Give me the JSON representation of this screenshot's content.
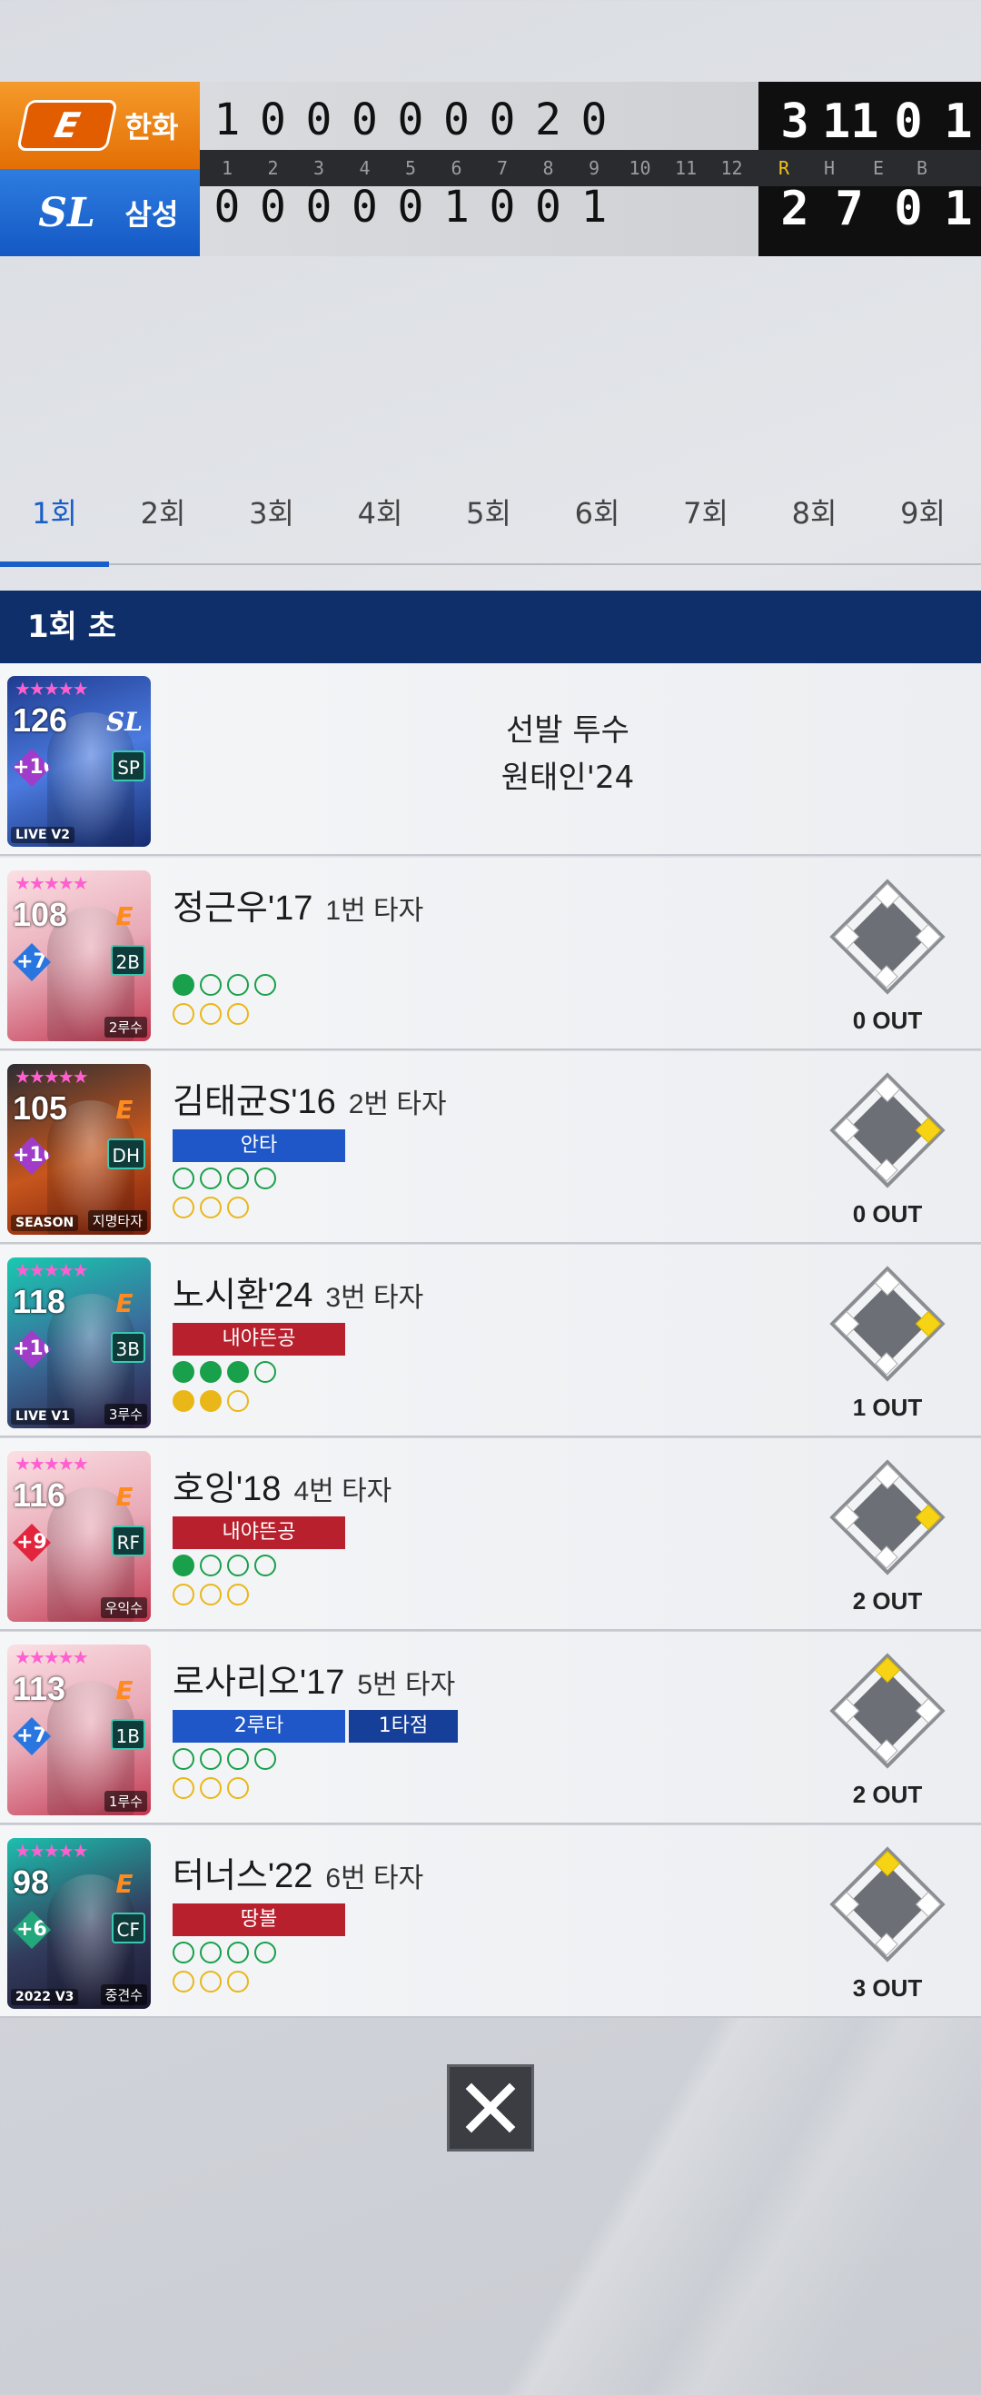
{
  "scoreboard": {
    "away": {
      "name": "한화",
      "innings": [
        "1",
        "0",
        "0",
        "0",
        "0",
        "0",
        "0",
        "2",
        "0"
      ],
      "totals": [
        "3",
        "11",
        "0",
        "1"
      ]
    },
    "home": {
      "name": "삼성",
      "innings": [
        "0",
        "0",
        "0",
        "0",
        "0",
        "1",
        "0",
        "0",
        "1"
      ],
      "totals": [
        "2",
        "7",
        "0",
        "1"
      ]
    },
    "inning_numbers": [
      "1",
      "2",
      "3",
      "4",
      "5",
      "6",
      "7",
      "8",
      "9",
      "10",
      "11",
      "12"
    ],
    "total_headers": [
      "R",
      "H",
      "E",
      "B"
    ]
  },
  "tabs": [
    "1회",
    "2회",
    "3회",
    "4회",
    "5회",
    "6회",
    "7회",
    "8회",
    "9회"
  ],
  "active_tab": 0,
  "inning_header": "1회 초",
  "pitcher": {
    "role_label": "선발 투수",
    "name": "원태인'24",
    "ovr": "126",
    "plus": "+10",
    "position": "SP",
    "tag": "LIVE V2"
  },
  "batters": [
    {
      "name": "정근우'17",
      "order": "1번 타자",
      "ovr": "108",
      "plus": "+7",
      "position": "2B",
      "role": "2루수",
      "tag": "",
      "results": [],
      "balls": 1,
      "outs_dots": 0,
      "bases": {
        "first": false,
        "second": false,
        "third": false
      },
      "out_text": "0 OUT"
    },
    {
      "name": "김태균S'16",
      "order": "2번 타자",
      "ovr": "105",
      "plus": "+10",
      "position": "DH",
      "role": "지명타자",
      "tag": "SEASON",
      "results": [
        "안타"
      ],
      "balls": 0,
      "outs_dots": 0,
      "bases": {
        "first": true,
        "second": false,
        "third": false
      },
      "out_text": "0 OUT"
    },
    {
      "name": "노시환'24",
      "order": "3번 타자",
      "ovr": "118",
      "plus": "+10",
      "position": "3B",
      "role": "3루수",
      "tag": "LIVE V1",
      "results": [
        "내야뜬공"
      ],
      "balls": 3,
      "outs_dots": 2,
      "bases": {
        "first": true,
        "second": false,
        "third": false
      },
      "out_text": "1 OUT"
    },
    {
      "name": "호잉'18",
      "order": "4번 타자",
      "ovr": "116",
      "plus": "+9",
      "position": "RF",
      "role": "우익수",
      "tag": "",
      "results": [
        "내야뜬공"
      ],
      "balls": 1,
      "outs_dots": 0,
      "bases": {
        "first": true,
        "second": false,
        "third": false
      },
      "out_text": "2 OUT"
    },
    {
      "name": "로사리오'17",
      "order": "5번 타자",
      "ovr": "113",
      "plus": "+7",
      "position": "1B",
      "role": "1루수",
      "tag": "",
      "results": [
        "2루타",
        "1타점"
      ],
      "balls": 0,
      "outs_dots": 0,
      "bases": {
        "first": false,
        "second": true,
        "third": false
      },
      "out_text": "2 OUT"
    },
    {
      "name": "터너스'22",
      "order": "6번 타자",
      "ovr": "98",
      "plus": "+6",
      "position": "CF",
      "role": "중견수",
      "tag": "2022 V3",
      "results": [
        "땅볼"
      ],
      "balls": 0,
      "outs_dots": 0,
      "bases": {
        "first": false,
        "second": true,
        "third": false
      },
      "out_text": "3 OUT"
    }
  ],
  "colors": {
    "away_team": "#e36f05",
    "home_team": "#1458c4",
    "inning_header_bg": "#0e2f6a",
    "hit": "#1f57c8",
    "out": "#b8202e",
    "runner": "#f6d415"
  }
}
